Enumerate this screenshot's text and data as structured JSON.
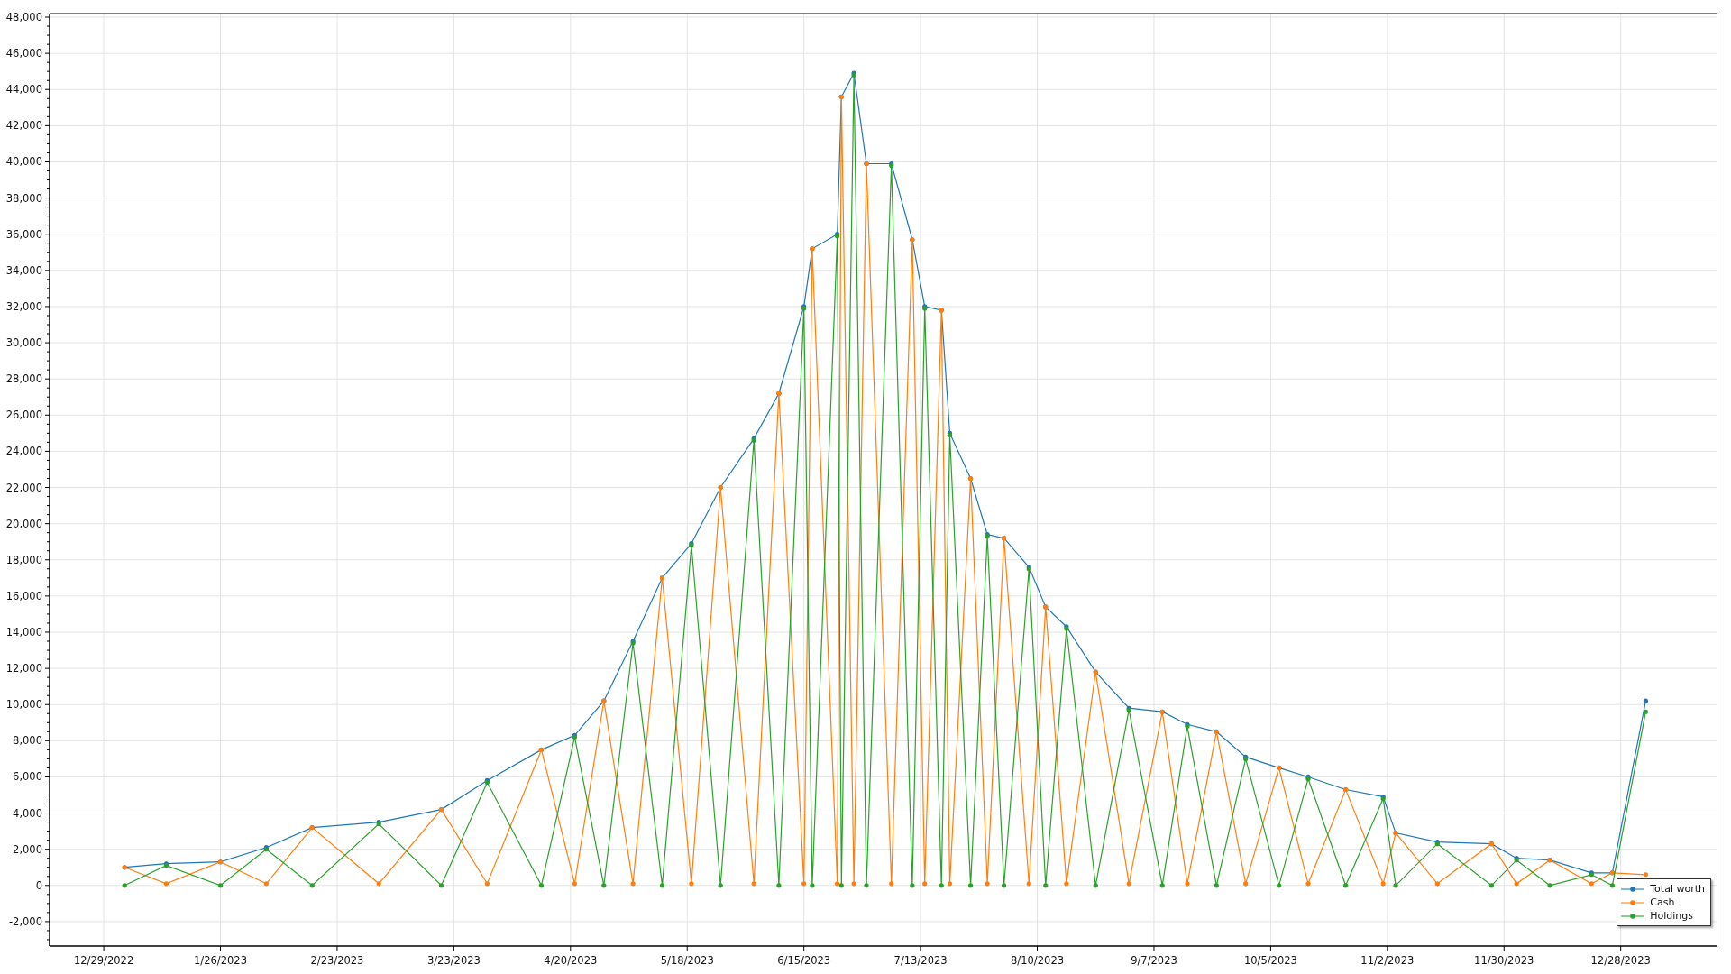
{
  "chart": {
    "chart_data": {
      "type": "line",
      "grid": true,
      "x": [
        "2023-01-03",
        "2023-01-13",
        "2023-01-26",
        "2023-02-06",
        "2023-02-17",
        "2023-03-05",
        "2023-03-20",
        "2023-03-31",
        "2023-04-13",
        "2023-04-21",
        "2023-04-28",
        "2023-05-05",
        "2023-05-12",
        "2023-05-19",
        "2023-05-26",
        "2023-06-03",
        "2023-06-09",
        "2023-06-15",
        "2023-06-17",
        "2023-06-23",
        "2023-06-24",
        "2023-06-27",
        "2023-06-30",
        "2023-07-06",
        "2023-07-11",
        "2023-07-14",
        "2023-07-18",
        "2023-07-20",
        "2023-07-25",
        "2023-07-29",
        "2023-08-02",
        "2023-08-08",
        "2023-08-12",
        "2023-08-17",
        "2023-08-24",
        "2023-09-01",
        "2023-09-09",
        "2023-09-15",
        "2023-09-22",
        "2023-09-29",
        "2023-10-07",
        "2023-10-14",
        "2023-10-23",
        "2023-11-01",
        "2023-11-04",
        "2023-11-14",
        "2023-11-27",
        "2023-12-03",
        "2023-12-11",
        "2023-12-21",
        "2023-12-26",
        "2024-01-03"
      ],
      "series": [
        {
          "name": "Total worth",
          "color": "#1f77b4",
          "values": [
            1000,
            1200,
            1300,
            2100,
            3200,
            3500,
            4200,
            5800,
            7500,
            8300,
            10200,
            13500,
            17000,
            18900,
            22000,
            24700,
            27200,
            32000,
            35200,
            36000,
            43600,
            44900,
            39900,
            39900,
            35700,
            32000,
            31800,
            25000,
            22500,
            19400,
            19200,
            17600,
            15400,
            14300,
            11800,
            9800,
            9600,
            8900,
            8500,
            7100,
            6500,
            6000,
            5300,
            4900,
            2900,
            2400,
            2300,
            1500,
            1400,
            700,
            700,
            10200
          ]
        },
        {
          "name": "Cash",
          "color": "#ff7f0e",
          "values": [
            1000,
            100,
            1300,
            100,
            3200,
            100,
            4200,
            100,
            7500,
            100,
            10200,
            100,
            17000,
            100,
            22000,
            100,
            27200,
            100,
            35200,
            100,
            43600,
            100,
            39900,
            100,
            35700,
            100,
            31800,
            100,
            22500,
            100,
            19200,
            100,
            15400,
            100,
            11800,
            100,
            9600,
            100,
            8500,
            100,
            6500,
            100,
            5300,
            100,
            2900,
            100,
            2300,
            100,
            1400,
            100,
            700,
            600
          ]
        },
        {
          "name": "Holdings",
          "color": "#2ca02c",
          "values": [
            0,
            1100,
            0,
            2000,
            0,
            3400,
            0,
            5700,
            0,
            8200,
            0,
            13400,
            0,
            18800,
            0,
            24600,
            0,
            31900,
            0,
            35900,
            0,
            44800,
            0,
            39800,
            0,
            31900,
            0,
            24900,
            0,
            19300,
            0,
            17500,
            0,
            14200,
            0,
            9700,
            0,
            8800,
            0,
            7000,
            0,
            5900,
            0,
            4800,
            0,
            2300,
            0,
            1400,
            0,
            600,
            0,
            9600
          ]
        }
      ],
      "xlim": [
        "2022-12-16",
        "2024-01-20"
      ],
      "ylim": [
        -3350,
        48200
      ],
      "xticks": [
        {
          "value": "2022-12-29",
          "label": "12/29/2022"
        },
        {
          "value": "2023-01-26",
          "label": "1/26/2023"
        },
        {
          "value": "2023-02-23",
          "label": "2/23/2023"
        },
        {
          "value": "2023-03-23",
          "label": "3/23/2023"
        },
        {
          "value": "2023-04-20",
          "label": "4/20/2023"
        },
        {
          "value": "2023-05-18",
          "label": "5/18/2023"
        },
        {
          "value": "2023-06-15",
          "label": "6/15/2023"
        },
        {
          "value": "2023-07-13",
          "label": "7/13/2023"
        },
        {
          "value": "2023-08-10",
          "label": "8/10/2023"
        },
        {
          "value": "2023-09-07",
          "label": "9/7/2023"
        },
        {
          "value": "2023-10-05",
          "label": "10/5/2023"
        },
        {
          "value": "2023-11-02",
          "label": "11/2/2023"
        },
        {
          "value": "2023-11-30",
          "label": "11/30/2023"
        },
        {
          "value": "2023-12-28",
          "label": "12/28/2023"
        }
      ],
      "yticks": [
        {
          "value": -2000,
          "label": "-2,000"
        },
        {
          "value": 0,
          "label": "0"
        },
        {
          "value": 2000,
          "label": "2,000"
        },
        {
          "value": 4000,
          "label": "4,000"
        },
        {
          "value": 6000,
          "label": "6,000"
        },
        {
          "value": 8000,
          "label": "8,000"
        },
        {
          "value": 10000,
          "label": "10,000"
        },
        {
          "value": 12000,
          "label": "12,000"
        },
        {
          "value": 14000,
          "label": "14,000"
        },
        {
          "value": 16000,
          "label": "16,000"
        },
        {
          "value": 18000,
          "label": "18,000"
        },
        {
          "value": 20000,
          "label": "20,000"
        },
        {
          "value": 22000,
          "label": "22,000"
        },
        {
          "value": 24000,
          "label": "24,000"
        },
        {
          "value": 26000,
          "label": "26,000"
        },
        {
          "value": 28000,
          "label": "28,000"
        },
        {
          "value": 30000,
          "label": "30,000"
        },
        {
          "value": 32000,
          "label": "32,000"
        },
        {
          "value": 34000,
          "label": "34,000"
        },
        {
          "value": 36000,
          "label": "36,000"
        },
        {
          "value": 38000,
          "label": "38,000"
        },
        {
          "value": 40000,
          "label": "40,000"
        },
        {
          "value": 42000,
          "label": "42,000"
        },
        {
          "value": 44000,
          "label": "44,000"
        },
        {
          "value": 46000,
          "label": "46,000"
        },
        {
          "value": 48000,
          "label": "48,000"
        }
      ]
    }
  }
}
